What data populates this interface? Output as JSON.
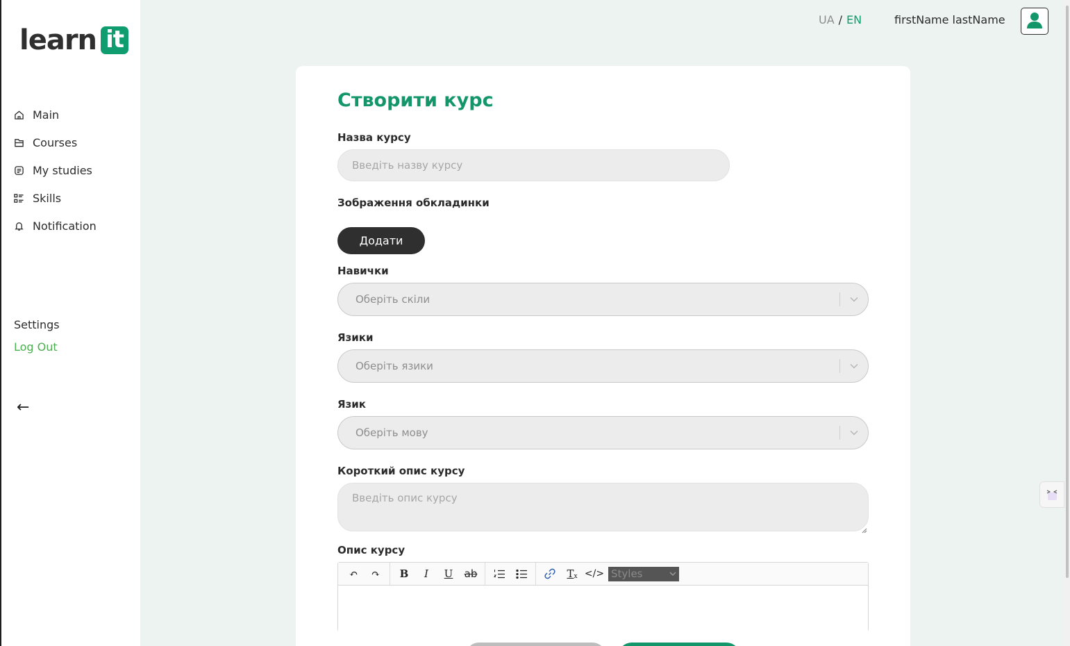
{
  "brand": {
    "logo_text": "learn",
    "logo_badge": "it",
    "accent_color": "#13966a"
  },
  "sidebar": {
    "items": [
      {
        "label": "Main",
        "icon": "home-icon"
      },
      {
        "label": "Courses",
        "icon": "folder-icon"
      },
      {
        "label": "My studies",
        "icon": "studies-icon"
      },
      {
        "label": "Skills",
        "icon": "list-icon"
      },
      {
        "label": "Notification",
        "icon": "bell-icon"
      }
    ],
    "settings_label": "Settings",
    "logout_label": "Log Out",
    "back_icon": "arrow-left-icon",
    "back_glyph": "←"
  },
  "header": {
    "lang_ua": "UA",
    "lang_sep": "/",
    "lang_en": "EN",
    "active_lang": "EN",
    "user_name": "firstName lastName",
    "avatar_icon": "user-icon"
  },
  "form": {
    "title": "Створити курс",
    "course_name_label": "Назва курсу",
    "course_name_placeholder": "Введіть назву курсу",
    "cover_label": "Зображення обкладинки",
    "add_button": "Додати",
    "skills_label": "Навички",
    "skills_placeholder": "Оберіть скіли",
    "languages_label": "Язики",
    "languages_placeholder": "Оберіть язики",
    "language_label": "Язик",
    "language_placeholder": "Оберіть мову",
    "short_desc_label": "Короткий опис курсу",
    "short_desc_placeholder": "Введіть опис курсу",
    "desc_label": "Опис курсу",
    "editor": {
      "undo": "↶",
      "redo": "↷",
      "bold": "B",
      "italic": "I",
      "underline": "U",
      "strike": "ab",
      "clear_format": "T",
      "clear_format_sub": "x",
      "code": "</>",
      "styles_placeholder": "Styles"
    }
  }
}
